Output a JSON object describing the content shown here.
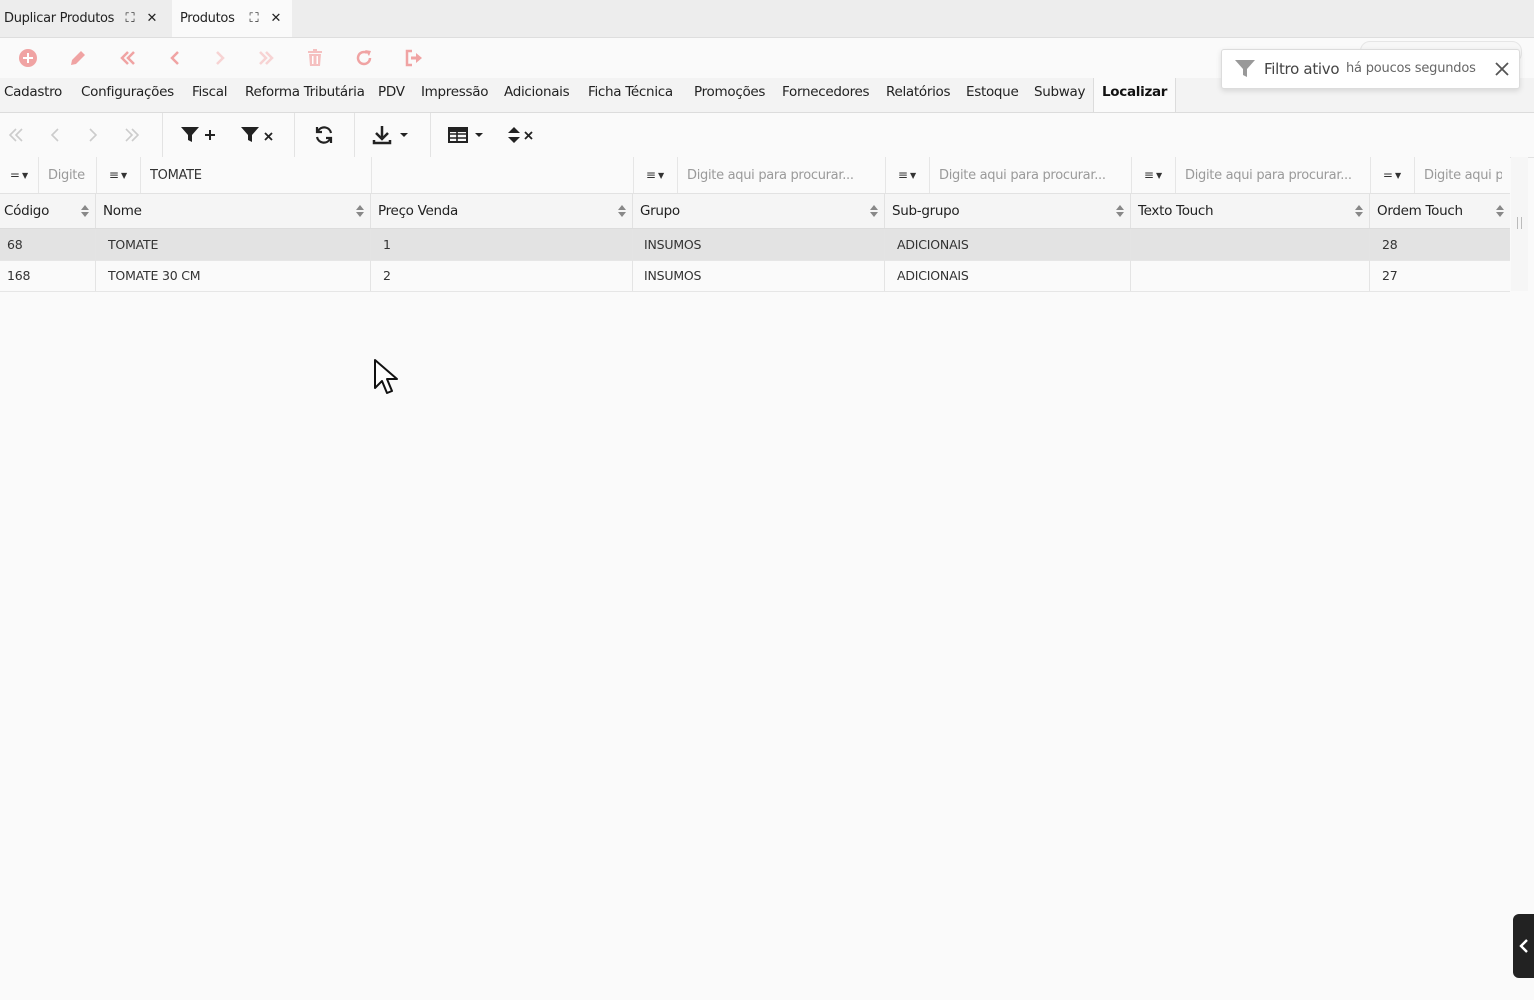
{
  "doc_tabs": [
    {
      "label": "Duplicar Produtos",
      "active": false
    },
    {
      "label": "Produtos",
      "active": true
    }
  ],
  "toolbar": {
    "accent_color": "#f0a3a3",
    "buttons": [
      "add-icon",
      "edit-icon",
      "first-record-icon",
      "previous-record-icon",
      "next-record-icon",
      "last-record-icon",
      "delete-icon",
      "refresh-icon",
      "exit-icon"
    ]
  },
  "toast": {
    "title": "Filtro ativo",
    "subtitle": "há poucos segundos"
  },
  "menu_tabs": [
    {
      "label": "Cadastro"
    },
    {
      "label": "Configurações"
    },
    {
      "label": "Fiscal"
    },
    {
      "label": "Reforma Tributária"
    },
    {
      "label": "PDV"
    },
    {
      "label": "Impressão"
    },
    {
      "label": "Adicionais"
    },
    {
      "label": "Ficha Técnica"
    },
    {
      "label": "Promoções"
    },
    {
      "label": "Fornecedores"
    },
    {
      "label": "Relatórios"
    },
    {
      "label": "Estoque"
    },
    {
      "label": "Subway"
    },
    {
      "label": "Localizar",
      "active": true
    }
  ],
  "filters": {
    "codigo": {
      "operator": "=",
      "placeholder": "Digite",
      "value": ""
    },
    "nome": {
      "operator": "≡",
      "placeholder": "",
      "value": "TOMATE"
    },
    "grupo": {
      "operator": "≡",
      "placeholder": "Digite aqui para procurar...",
      "value": ""
    },
    "subgrupo": {
      "operator": "≡",
      "placeholder": "Digite aqui para procurar...",
      "value": ""
    },
    "texto_touch": {
      "operator": "≡",
      "placeholder": "Digite aqui para procurar...",
      "value": ""
    },
    "ordem_touch": {
      "operator": "=",
      "placeholder": "Digite aqui para procurar...",
      "value": ""
    }
  },
  "columns": [
    "Código",
    "Nome",
    "Preço Venda",
    "Grupo",
    "Sub-grupo",
    "Texto Touch",
    "Ordem Touch"
  ],
  "rows": [
    {
      "codigo": "68",
      "nome": "TOMATE",
      "preco": "1",
      "grupo": "INSUMOS",
      "subgrupo": "ADICIONAIS",
      "texto_touch": "",
      "ordem_touch": "28",
      "selected": true
    },
    {
      "codigo": "168",
      "nome": "TOMATE 30 CM",
      "preco": "2",
      "grupo": "INSUMOS",
      "subgrupo": "ADICIONAIS",
      "texto_touch": "",
      "ordem_touch": "27",
      "selected": false
    }
  ]
}
